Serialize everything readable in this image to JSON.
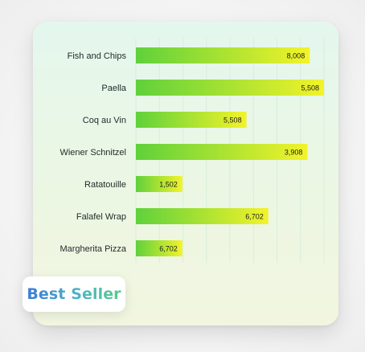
{
  "badge": {
    "label": "Best Seller"
  },
  "colors": {
    "bar_start": "#5fd13b",
    "bar_end": "#f3f32a",
    "label_text": "#1f2a2a",
    "value_text": "#1a1a1a",
    "grid": "#d7eedd"
  },
  "chart_data": {
    "type": "bar",
    "orientation": "horizontal",
    "categories": [
      "Fish and Chips",
      "Paella",
      "Coq au Vin",
      "Wiener Schnitzel",
      "Ratatouille",
      "Falafel Wrap",
      "Margherita Pizza"
    ],
    "values": [
      8008,
      5508,
      5508,
      3908,
      1502,
      6702,
      6702
    ],
    "value_labels": [
      "8,008",
      "5,508",
      "5,508",
      "3,908",
      "1,502",
      "6,702",
      "6,702"
    ],
    "bar_fraction": [
      0.924,
      1.0,
      0.588,
      0.912,
      0.247,
      0.704,
      0.247
    ],
    "title": "",
    "xlabel": "",
    "ylabel": "",
    "grid": true,
    "legend": "none"
  }
}
